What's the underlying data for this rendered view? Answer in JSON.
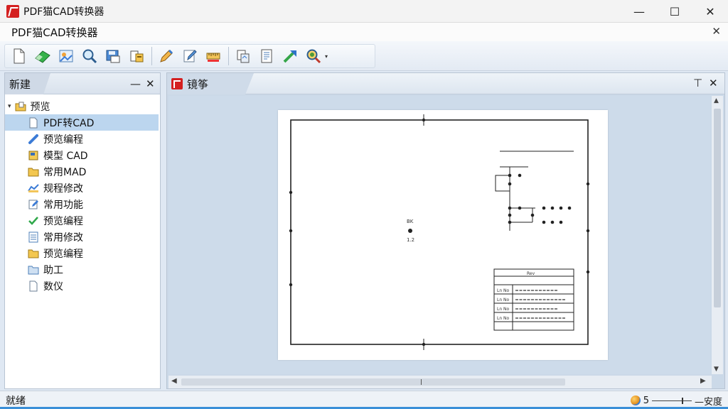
{
  "window": {
    "title": "PDF猫CAD转换器",
    "minimize_glyph": "—",
    "maximize_glyph": "☐",
    "close_glyph": "✕"
  },
  "menubar": {
    "doc_title": "PDF猫CAD转换器",
    "close_glyph": "✕"
  },
  "toolbar": {
    "buttons": [
      "new-file-icon",
      "eraser-icon",
      "image-convert-icon",
      "zoom-icon",
      "save-icon",
      "print-icon",
      "pen-tool-icon",
      "edit-pen-icon",
      "ruler-icon",
      "layers-icon",
      "document-list-icon",
      "arrow-diagonal-icon",
      "search-zoom-icon"
    ],
    "dropdown_glyph": "▾"
  },
  "left_panel": {
    "tab_label": "新建",
    "pin_glyph": "—",
    "close_glyph": "✕",
    "root": {
      "caret": "▾",
      "label": "预览"
    },
    "items": [
      {
        "label": "PDF转CAD",
        "icon": "file-outline-icon",
        "selected": true
      },
      {
        "label": "预览编程",
        "icon": "link-icon",
        "selected": false
      },
      {
        "label": "模型 CAD",
        "icon": "document-yellow-icon",
        "selected": false
      },
      {
        "label": "常用MAD",
        "icon": "folder-icon",
        "selected": false
      },
      {
        "label": "规程修改",
        "icon": "graph-icon",
        "selected": false
      },
      {
        "label": "常用功能",
        "icon": "edit-icon",
        "selected": false
      },
      {
        "label": "预览编程",
        "icon": "check-icon",
        "selected": false
      },
      {
        "label": "常用修改",
        "icon": "list-icon",
        "selected": false
      },
      {
        "label": "预览编程",
        "icon": "folder-icon",
        "selected": false
      },
      {
        "label": "助工",
        "icon": "folder-open-icon",
        "selected": false
      },
      {
        "label": "数仪",
        "icon": "file-outline-icon",
        "selected": false
      }
    ]
  },
  "doc_panel": {
    "tab_label": "镜筝",
    "pin_glyph": "⊤",
    "close_glyph": "✕"
  },
  "drawing": {
    "title_block_header": "Rev",
    "table_rows": [
      "Ln No",
      "Ln No",
      "Ln No",
      "Ln No"
    ],
    "center_label_top": "BK",
    "center_label_bottom": "1.2"
  },
  "statusbar": {
    "left_text": "就绪",
    "zoom_value": "5",
    "zoom_label": "—安度"
  }
}
